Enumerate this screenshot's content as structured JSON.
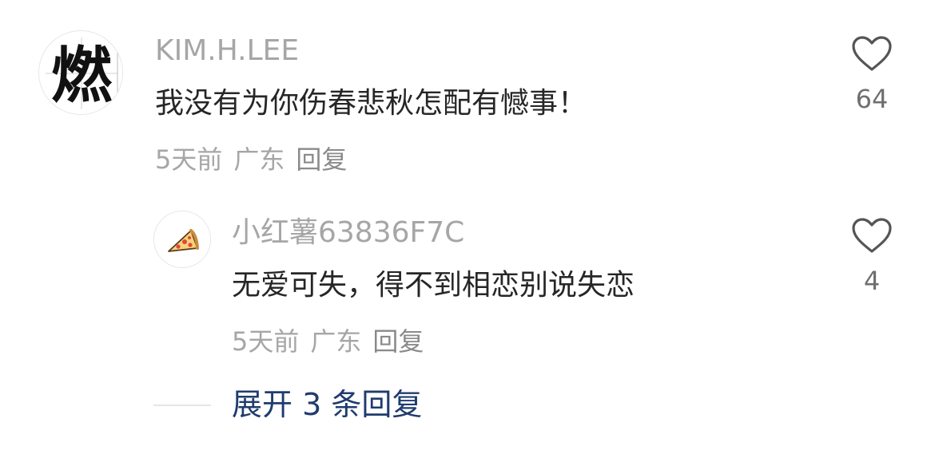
{
  "comment": {
    "username": "KIM.H.LEE",
    "text": "我没有为你伤春悲秋怎配有憾事！",
    "time": "5天前",
    "location": "广东",
    "reply_label": "回复",
    "likes": "64",
    "avatar_glyph": "燃"
  },
  "reply": {
    "username": "小红薯63836F7C",
    "text": "无爱可失，得不到相恋别说失恋",
    "time": "5天前",
    "location": "广东",
    "reply_label": "回复",
    "likes": "4",
    "avatar_icon": "pizza-icon"
  },
  "expand": {
    "label": "展开 3 条回复"
  },
  "colors": {
    "username": "#a6a6a6",
    "text": "#262626",
    "meta": "#a6a6a6",
    "expand": "#1f3c6e",
    "heart_stroke": "#555555"
  }
}
